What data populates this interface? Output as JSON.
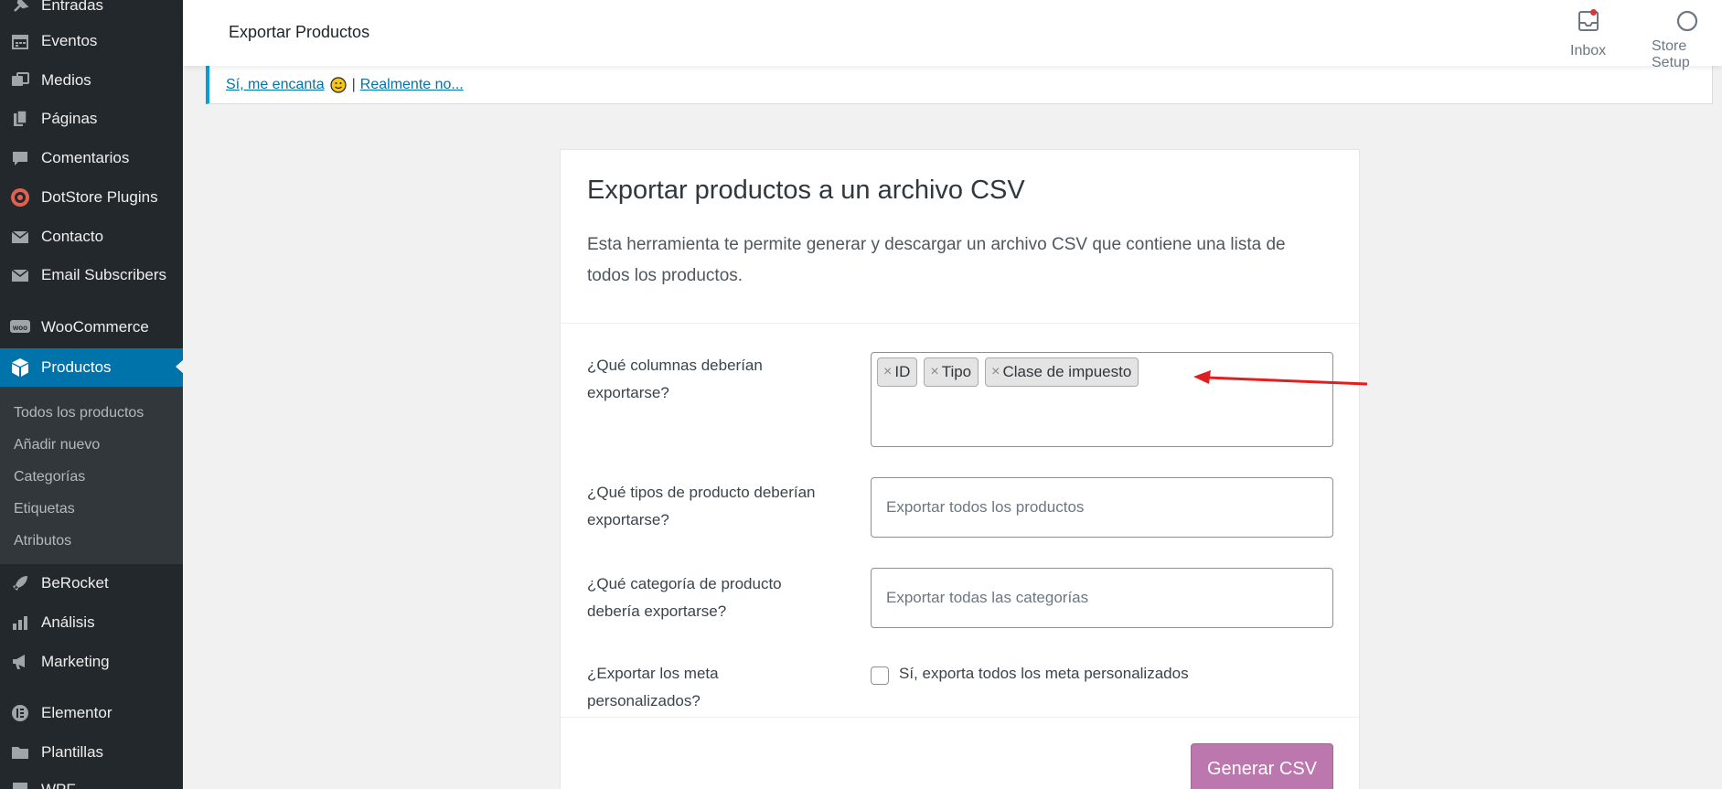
{
  "sidebar": {
    "items": [
      {
        "label": "Entradas",
        "icon": "pin-icon"
      },
      {
        "label": "Eventos",
        "icon": "calendar-icon"
      },
      {
        "label": "Medios",
        "icon": "media-icon"
      },
      {
        "label": "Páginas",
        "icon": "pages-icon"
      },
      {
        "label": "Comentarios",
        "icon": "comment-icon"
      },
      {
        "label": "DotStore Plugins",
        "icon": "dotstore-icon"
      },
      {
        "label": "Contacto",
        "icon": "mail-icon"
      },
      {
        "label": "Email Subscribers",
        "icon": "mail-icon"
      },
      {
        "label": "WooCommerce",
        "icon": "woo-icon"
      },
      {
        "label": "Productos",
        "icon": "box-icon",
        "active": true
      },
      {
        "label": "BeRocket",
        "icon": "rocket-icon"
      },
      {
        "label": "Análisis",
        "icon": "bar-chart-icon"
      },
      {
        "label": "Marketing",
        "icon": "megaphone-icon"
      },
      {
        "label": "Elementor",
        "icon": "elementor-icon"
      },
      {
        "label": "Plantillas",
        "icon": "folder-icon"
      },
      {
        "label": "WPF",
        "icon": "wpf-icon"
      }
    ],
    "submenu": [
      "Todos los productos",
      "Añadir nuevo",
      "Categorías",
      "Etiquetas",
      "Atributos"
    ]
  },
  "topbar": {
    "title": "Exportar Productos",
    "inbox_label": "Inbox",
    "store_setup_label": "Store Setup"
  },
  "notice": {
    "yes_link": "Sí, me encanta",
    "separator": "|",
    "no_link": "Realmente no..."
  },
  "card": {
    "title": "Exportar productos a un archivo CSV",
    "description": "Esta herramienta te permite generar y descargar un archivo CSV que contiene una lista de todos los productos.",
    "columns_label": "¿Qué columnas deberían exportarse?",
    "columns_tags": [
      "ID",
      "Tipo",
      "Clase de impuesto"
    ],
    "types_label": "¿Qué tipos de producto deberían exportarse?",
    "types_placeholder": "Exportar todos los productos",
    "category_label": "¿Qué categoría de producto debería exportarse?",
    "category_placeholder": "Exportar todas las categorías",
    "meta_label": "¿Exportar los meta personalizados?",
    "meta_checkbox_label": "Sí, exporta todos los meta personalizados",
    "generate_button": "Generar CSV"
  },
  "colors": {
    "sidebar_bg": "#23282d",
    "active": "#0073aa",
    "button": "#bb77ae",
    "annotation": "#e02020"
  }
}
